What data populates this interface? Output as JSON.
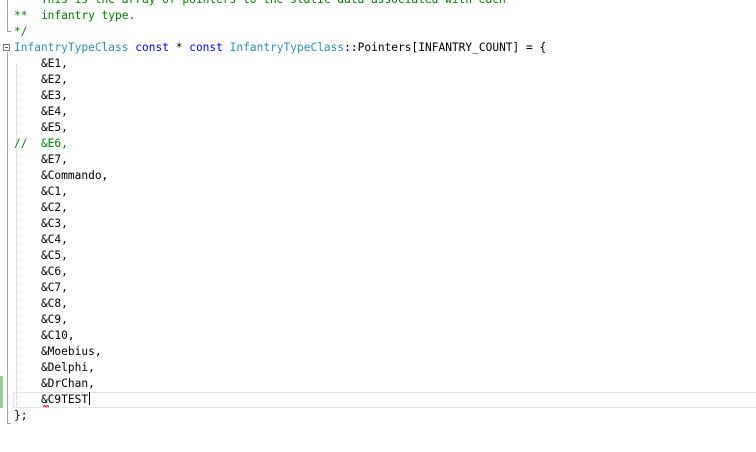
{
  "editor": {
    "comment_lines": [
      "**  This is the array of pointers to the static data associated with each",
      "**  infantry type.",
      "*/"
    ],
    "declaration": {
      "type": "InfantryTypeClass",
      "const1": "const",
      "star": "*",
      "const2": "const",
      "class_name": "InfantryTypeClass",
      "rest": "::Pointers[INFANTRY_COUNT] = {"
    },
    "entries": [
      "    &E1,",
      "    &E2,",
      "    &E3,",
      "    &E4,",
      "    &E5,",
      "//  &E6,",
      "    &E7,",
      "    &Commando,",
      "    &C1,",
      "    &C2,",
      "    &C3,",
      "    &C4,",
      "    &C5,",
      "    &C6,",
      "    &C7,",
      "    &C8,",
      "    &C9,",
      "    &C10,",
      "    &Moebius,",
      "    &Delphi,",
      "    &DrChan,",
      "    &C9TEST"
    ],
    "closing": "};",
    "colors": {
      "comment": "#008000",
      "type": "#2b91af",
      "keyword": "#0000ff",
      "change_bar": "#8fd48f",
      "squiggle": "#e51400"
    }
  }
}
